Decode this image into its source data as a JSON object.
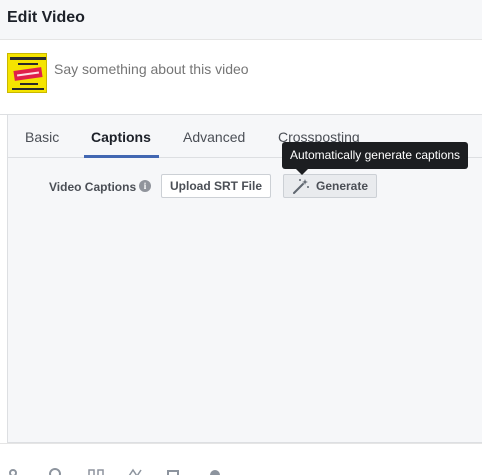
{
  "header": {
    "title": "Edit Video"
  },
  "compose": {
    "thumbnail_text": "THE LANCASHIRE HOTPOTS SEYRE WORK NETFRI SETT0008A",
    "placeholder": "Say something about this video"
  },
  "tabs": [
    {
      "label": "Basic"
    },
    {
      "label": "Captions",
      "active": true
    },
    {
      "label": "Advanced"
    },
    {
      "label": "Crossposting"
    }
  ],
  "captions": {
    "label": "Video Captions",
    "info_icon": "info-icon",
    "upload_button": "Upload SRT File",
    "generate_button": "Generate",
    "generate_icon": "magic-wand-icon"
  },
  "tooltip": {
    "text": "Automatically generate captions"
  },
  "footer_icons": [
    "tag-icon",
    "location-icon",
    "feeling-icon",
    "sticker-icon",
    "bag-icon",
    "more-icon"
  ],
  "colors": {
    "accent": "#4267b2",
    "tooltip_bg": "#1c1e21",
    "panel_bg": "#f6f7f9"
  }
}
